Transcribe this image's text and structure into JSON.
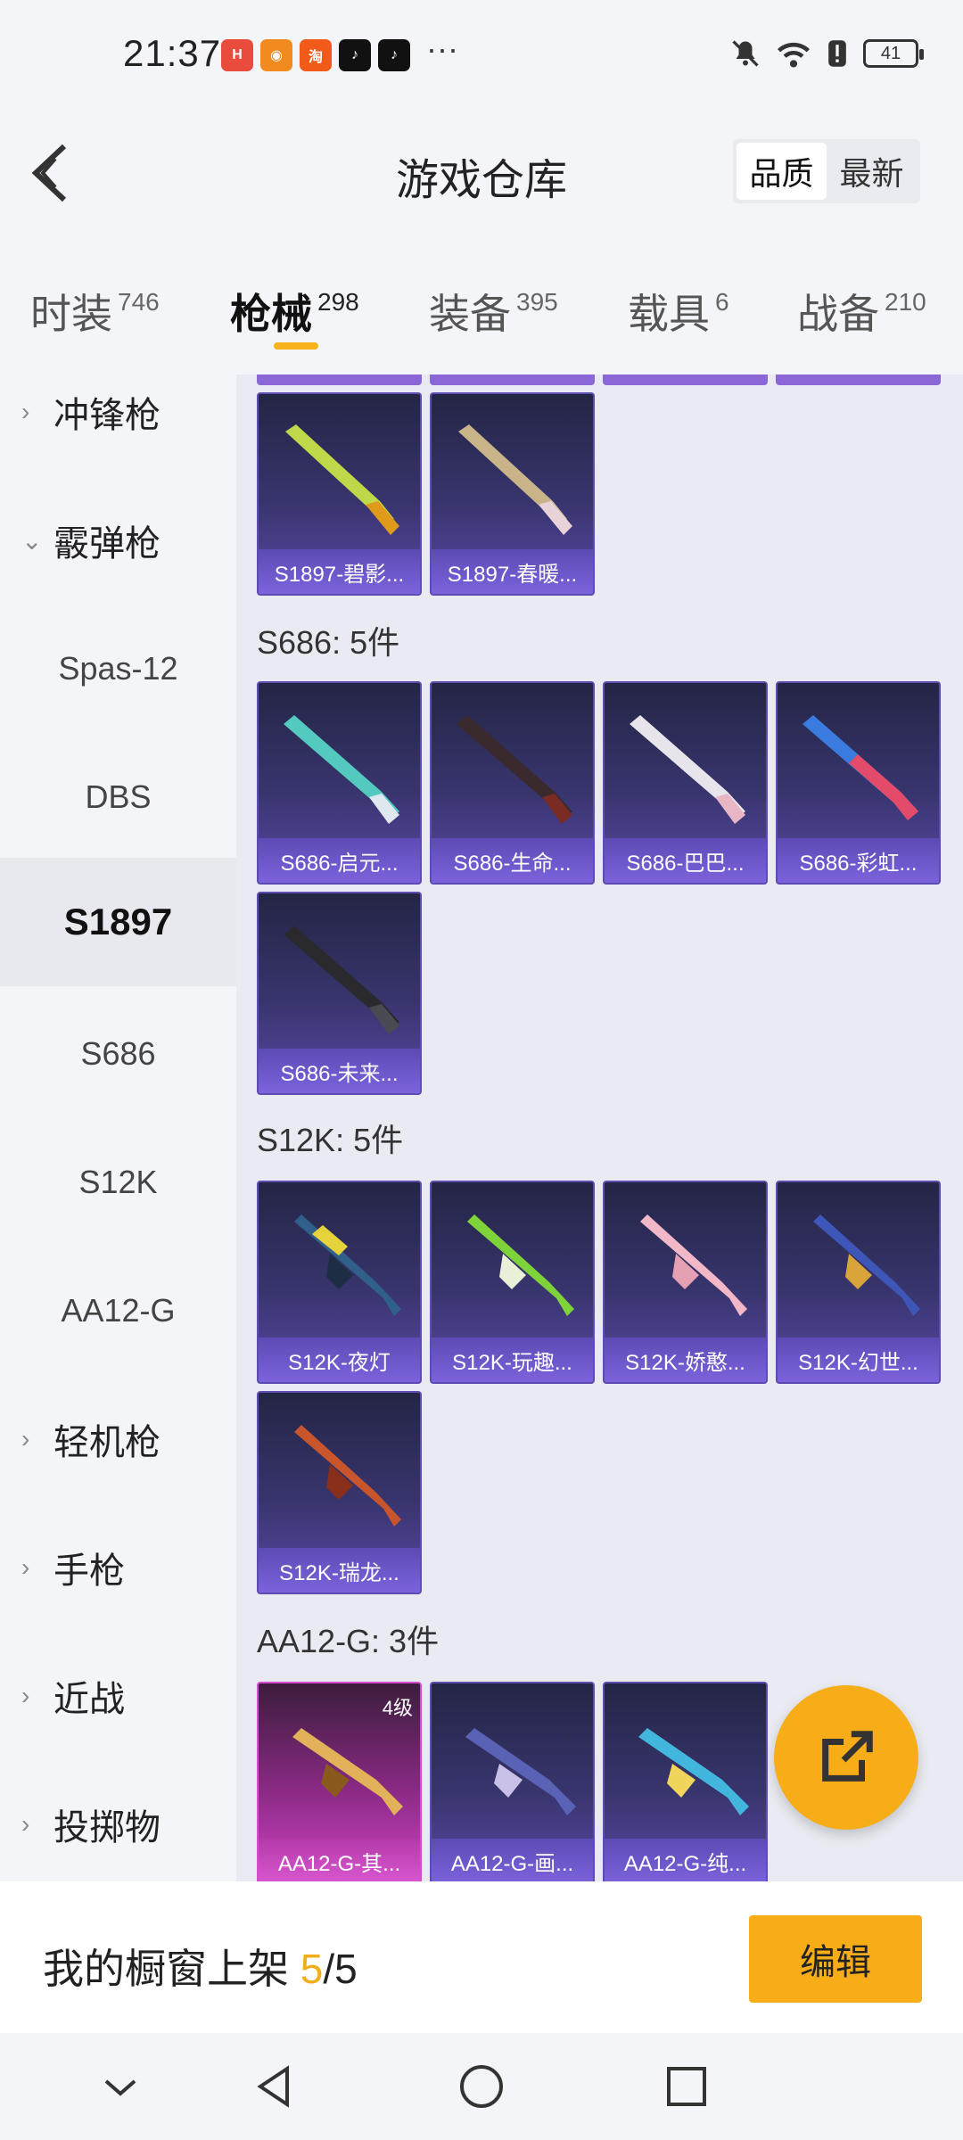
{
  "status_bar": {
    "time": "21:37",
    "battery": "41",
    "more": "···"
  },
  "header": {
    "title": "游戏仓库",
    "sort_options": [
      "品质",
      "最新"
    ]
  },
  "tabs": [
    {
      "label": "时装",
      "count": "746"
    },
    {
      "label": "枪械",
      "count": "298"
    },
    {
      "label": "装备",
      "count": "395"
    },
    {
      "label": "载具",
      "count": "6"
    },
    {
      "label": "战备",
      "count": "210"
    }
  ],
  "sidebar": {
    "items": [
      {
        "label": "冲锋枪"
      },
      {
        "label": "霰弹枪"
      },
      {
        "label": "Spas-12"
      },
      {
        "label": "DBS"
      },
      {
        "label": "S1897"
      },
      {
        "label": "S686"
      },
      {
        "label": "S12K"
      },
      {
        "label": "AA12-G"
      },
      {
        "label": "轻机枪"
      },
      {
        "label": "手枪"
      },
      {
        "label": "近战"
      },
      {
        "label": "投掷物"
      }
    ]
  },
  "main": {
    "s1897_items": [
      "S1897-碧影...",
      "S1897-春暖..."
    ],
    "s686": {
      "title": "S686: 5件",
      "items": [
        "S686-启元...",
        "S686-生命...",
        "S686-巴巴...",
        "S686-彩虹...",
        "S686-未来..."
      ]
    },
    "s12k": {
      "title": "S12K: 5件",
      "items": [
        "S12K-夜灯",
        "S12K-玩趣...",
        "S12K-娇憨...",
        "S12K-幻世...",
        "S12K-瑞龙..."
      ]
    },
    "aa12": {
      "title": "AA12-G: 3件",
      "items": [
        "AA12-G-其...",
        "AA12-G-画...",
        "AA12-G-纯..."
      ],
      "badge": "4级"
    }
  },
  "bottom": {
    "label": "我的橱窗上架 ",
    "count": "5",
    "total": "/5",
    "edit": "编辑"
  },
  "colors": {
    "accent": "#f7ad17",
    "card_purple": "#5d4db0",
    "card_legend": "#d244c8"
  }
}
